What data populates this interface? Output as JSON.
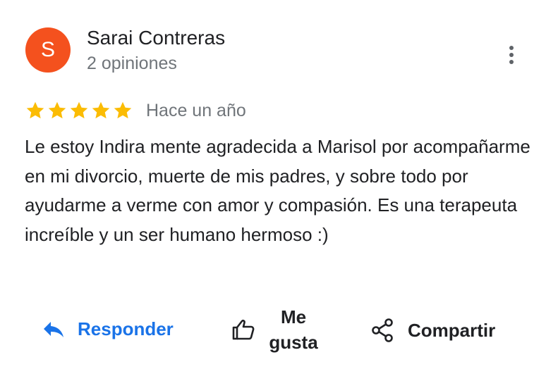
{
  "author": {
    "initial": "S",
    "name": "Sarai Contreras",
    "review_count": "2 opiniones",
    "avatar_color": "#f4511e"
  },
  "menu": {
    "icon": "more-vert-icon"
  },
  "review": {
    "rating": 5,
    "max_rating": 5,
    "star_color": "#fbbc04",
    "date": "Hace un año",
    "text": "Le estoy Indira mente agradecida a Marisol por acompañarme en mi divorcio, muerte de mis padres, y sobre todo por ayudarme a verme con amor y compasión. Es una terapeuta increíble y un ser humano hermoso :)"
  },
  "actions": {
    "reply": {
      "label": "Responder",
      "icon": "reply-icon",
      "color": "#1a73e8"
    },
    "like": {
      "label": "Me gusta",
      "icon": "thumb-up-icon"
    },
    "share": {
      "label": "Compartir",
      "icon": "share-icon"
    }
  }
}
